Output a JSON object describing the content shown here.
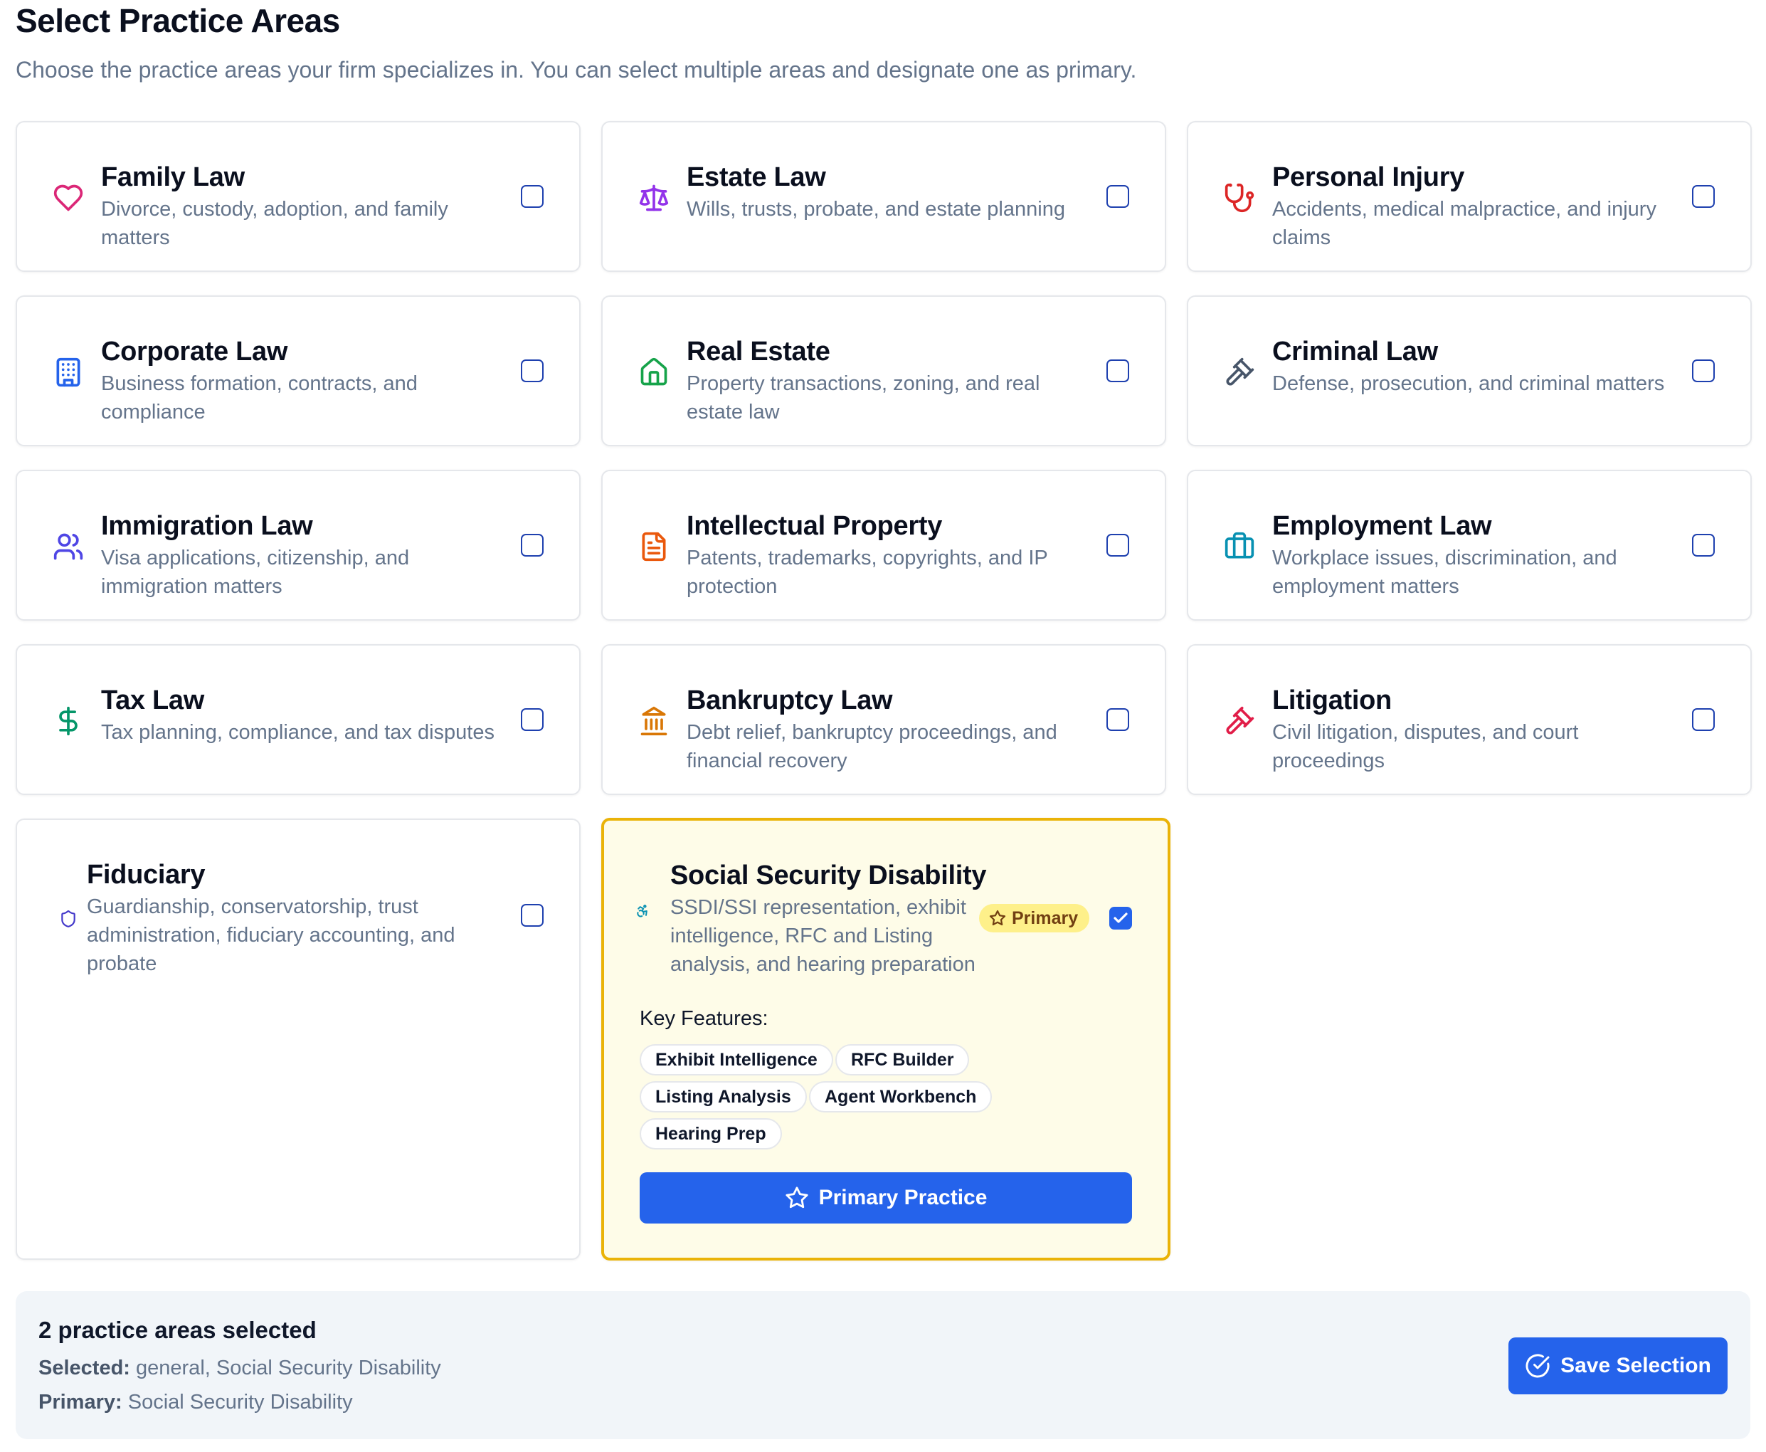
{
  "header": {
    "title": "Select Practice Areas",
    "subtitle": "Choose the practice areas your firm specializes in. You can select multiple areas and designate one as primary."
  },
  "colors": {
    "primary_blue": "#2563eb",
    "primary_card_bg": "#fefce8",
    "primary_card_border": "#eab308"
  },
  "areas": [
    {
      "title": "Family Law",
      "description": "Divorce, custody, adoption, and family matters",
      "icon": "heart-icon",
      "icon_color": "#db2777",
      "selected": false
    },
    {
      "title": "Estate Law",
      "description": "Wills, trusts, probate, and estate planning",
      "icon": "scale-icon",
      "icon_color": "#9333ea",
      "selected": false
    },
    {
      "title": "Personal Injury",
      "description": "Accidents, medical malpractice, and injury claims",
      "icon": "stethoscope-icon",
      "icon_color": "#dc2626",
      "selected": false
    },
    {
      "title": "Corporate Law",
      "description": "Business formation, contracts, and compliance",
      "icon": "building-icon",
      "icon_color": "#2563eb",
      "selected": false
    },
    {
      "title": "Real Estate",
      "description": "Property transactions, zoning, and real estate law",
      "icon": "home-icon",
      "icon_color": "#16a34a",
      "selected": false
    },
    {
      "title": "Criminal Law",
      "description": "Defense, prosecution, and criminal matters",
      "icon": "gavel-icon",
      "icon_color": "#475569",
      "selected": false
    },
    {
      "title": "Immigration Law",
      "description": "Visa applications, citizenship, and immigration matters",
      "icon": "users-icon",
      "icon_color": "#4f46e5",
      "selected": false
    },
    {
      "title": "Intellectual Property",
      "description": "Patents, trademarks, copyrights, and IP protection",
      "icon": "file-text-icon",
      "icon_color": "#ea580c",
      "selected": false
    },
    {
      "title": "Employment Law",
      "description": "Workplace issues, discrimination, and employment matters",
      "icon": "briefcase-icon",
      "icon_color": "#0891b2",
      "selected": false
    },
    {
      "title": "Tax Law",
      "description": "Tax planning, compliance, and tax disputes",
      "icon": "dollar-icon",
      "icon_color": "#059669",
      "selected": false
    },
    {
      "title": "Bankruptcy Law",
      "description": "Debt relief, bankruptcy proceedings, and financial recovery",
      "icon": "bank-icon",
      "icon_color": "#d97706",
      "selected": false
    },
    {
      "title": "Litigation",
      "description": "Civil litigation, disputes, and court proceedings",
      "icon": "gavel-icon",
      "icon_color": "#e11d48",
      "selected": false
    },
    {
      "title": "Fiduciary",
      "description": "Guardianship, conservatorship, trust administration, fiduciary accounting, and probate",
      "icon": "shield-icon",
      "icon_color": "#4338ca",
      "selected": false
    }
  ],
  "primary_area": {
    "title": "Social Security Disability",
    "description": "SSDI/SSI representation, exhibit intelligence, RFC and Listing analysis, and hearing preparation",
    "icon": "accessibility-icon",
    "icon_color": "#0891b2",
    "badge": "Primary",
    "selected": true,
    "key_features_label": "Key Features:",
    "features": [
      "Exhibit Intelligence",
      "RFC Builder",
      "Listing Analysis",
      "Agent Workbench",
      "Hearing Prep"
    ],
    "button_label": "Primary Practice"
  },
  "footer": {
    "count_text": "2 practice areas selected",
    "selected_label": "Selected:",
    "selected_value": "general, Social Security Disability",
    "primary_label": "Primary:",
    "primary_value": "Social Security Disability",
    "save_label": "Save Selection"
  }
}
